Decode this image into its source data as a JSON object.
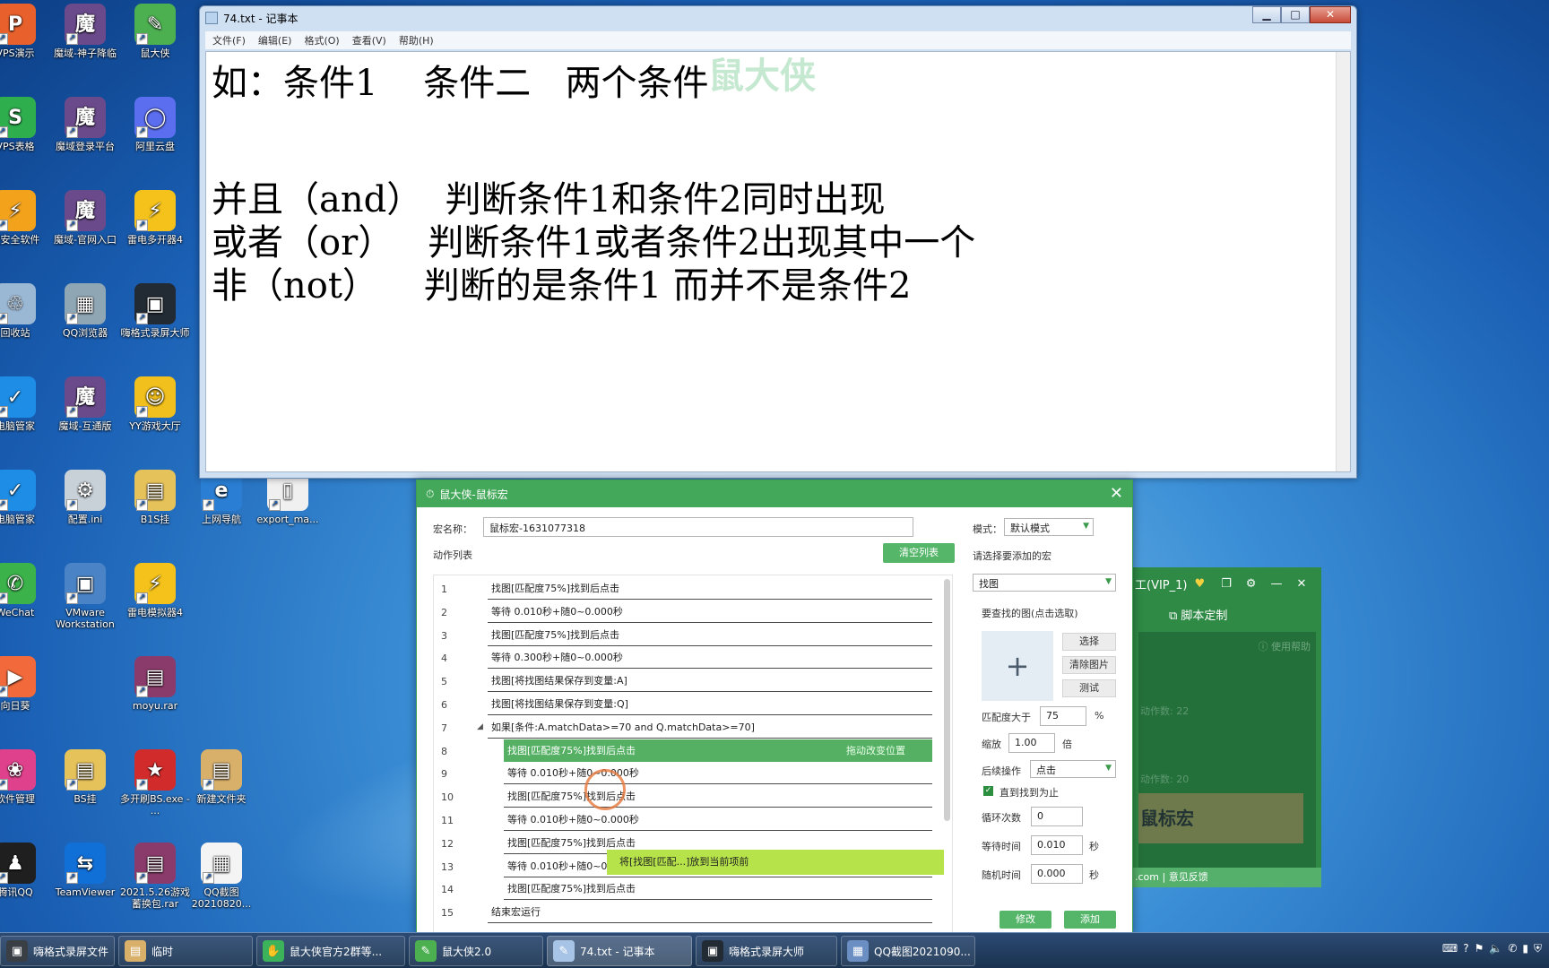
{
  "desktop": {
    "icons": [
      {
        "label": "VPS演示",
        "color": "#e8612c",
        "glyph": "P"
      },
      {
        "label": "魔域-神子降临",
        "color": "#6a4a8a",
        "glyph": "魔"
      },
      {
        "label": "鼠大侠",
        "color": "#4caf50",
        "glyph": "✎"
      },
      {
        "label": "VPS表格",
        "color": "#2fae4e",
        "glyph": "S"
      },
      {
        "label": "魔域登录平台",
        "color": "#6a4a8a",
        "glyph": "魔"
      },
      {
        "label": "阿里云盘",
        "color": "#5b6ef0",
        "glyph": "◯"
      },
      {
        "label": "被安全软件",
        "color": "#f3a21c",
        "glyph": "⚡"
      },
      {
        "label": "魔域-官网入口",
        "color": "#6a4a8a",
        "glyph": "魔"
      },
      {
        "label": "雷电多开器4",
        "color": "#f4c21a",
        "glyph": "⚡"
      },
      {
        "label": "回收站",
        "color": "#9ab7d3",
        "glyph": "♲"
      },
      {
        "label": "QQ浏览器",
        "color": "#8fa6b5",
        "glyph": "▦"
      },
      {
        "label": "嗨格式录屏大师",
        "color": "#222a33",
        "glyph": "▣"
      },
      {
        "label": "电脑管家",
        "color": "#1e8de6",
        "glyph": "✓"
      },
      {
        "label": "魔域-互通版",
        "color": "#6a4a8a",
        "glyph": "魔"
      },
      {
        "label": "YY游戏大厅",
        "color": "#f2c01c",
        "glyph": "☺"
      },
      {
        "label": "电脑管家",
        "color": "#1e8de6",
        "glyph": "✓"
      },
      {
        "label": "配置.ini",
        "color": "#c8d0d8",
        "glyph": "⚙"
      },
      {
        "label": "B1S挂",
        "color": "#e6c25a",
        "glyph": "▤"
      },
      {
        "label": "上网导航",
        "color": "#2a7fd4",
        "glyph": "e"
      },
      {
        "label": "export_ma...",
        "color": "#f0f0f0",
        "glyph": "▯"
      },
      {
        "label": "WeChat",
        "color": "#3bb24a",
        "glyph": "✆"
      },
      {
        "label": "VMware Workstation",
        "color": "#4a84c6",
        "glyph": "▣"
      },
      {
        "label": "雷电模拟器4",
        "color": "#f4c21a",
        "glyph": "⚡"
      },
      {
        "label": "moyu.rar",
        "color": "#8b3b6b",
        "glyph": "▤"
      },
      {
        "label": "向日葵",
        "color": "#f26a3b",
        "glyph": "▶"
      },
      {
        "label": "BS挂",
        "color": "#e6c25a",
        "glyph": "▤"
      },
      {
        "label": "多开刷BS.exe - ...",
        "color": "#d22b2b",
        "glyph": "★"
      },
      {
        "label": "新建文件夹",
        "color": "#d9b06a",
        "glyph": "▤"
      },
      {
        "label": "软件管理",
        "color": "#e0418c",
        "glyph": "❀"
      },
      {
        "label": "腾讯QQ",
        "color": "#1f1f1f",
        "glyph": "♟"
      },
      {
        "label": "TeamViewer",
        "color": "#1170d8",
        "glyph": "⇆"
      },
      {
        "label": "2021.5.26游戏蓄换包.rar",
        "color": "#8b3b6b",
        "glyph": "▤"
      },
      {
        "label": "QQ截图20210820...",
        "color": "#f4f4f4",
        "glyph": "▦"
      }
    ]
  },
  "notepad": {
    "title": "74.txt - 记事本",
    "menu": [
      "文件(F)",
      "编辑(E)",
      "格式(O)",
      "查看(V)",
      "帮助(H)"
    ],
    "watermark": "鼠大侠",
    "lines": [
      "如：条件1    条件二   两个条件",
      "并且（and）  判断条件1和条件2同时出现",
      "或者（or）   判断条件1或者条件2出现其中一个",
      "非（not）    判断的是条件1 而并不是条件2"
    ]
  },
  "macro": {
    "title": "鼠大侠-鼠标宏",
    "name_label": "宏名称：",
    "name_value": "鼠标宏-1631077318",
    "mode_label": "模式：",
    "mode_value": "默认模式",
    "list_label": "动作列表",
    "clear_btn": "清空列表",
    "choose_label": "请选择要添加的宏",
    "choose_value": "找图",
    "find_label": "要查找的图(点击选取)",
    "select_btn": "选择",
    "clear_img_btn": "清除图片",
    "test_btn": "测试",
    "match_label": "匹配度大于",
    "match_value": "75",
    "match_unit": "%",
    "scale_label": "缩放",
    "scale_value": "1.00",
    "scale_unit": "倍",
    "after_label": "后续操作",
    "after_value": "点击",
    "until_found": "直到找到为止",
    "loop_label": "循环次数",
    "loop_value": "0",
    "wait_label": "等待时间",
    "wait_value": "0.010",
    "wait_unit": "秒",
    "rand_label": "随机时间",
    "rand_value": "0.000",
    "rand_unit": "秒",
    "modify_btn": "修改",
    "add_btn": "添加",
    "drag_hint": "拖动改变位置",
    "drop_tip": "将[找图[匹配...]放到当前项前",
    "actions": [
      {
        "num": "1",
        "text": "找图[匹配度75%]找到后点击"
      },
      {
        "num": "2",
        "text": "等待 0.010秒+随0~0.000秒"
      },
      {
        "num": "3",
        "text": "找图[匹配度75%]找到后点击"
      },
      {
        "num": "4",
        "text": "等待 0.300秒+随0~0.000秒"
      },
      {
        "num": "5",
        "text": "找图[将找图结果保存到变量:A]"
      },
      {
        "num": "6",
        "text": "找图[将找图结果保存到变量:Q]"
      },
      {
        "num": "7",
        "text": "如果[条件:A.matchData>=70 and Q.matchData>=70]"
      },
      {
        "num": "8",
        "text": "找图[匹配度75%]找到后点击"
      },
      {
        "num": "9",
        "text": "等待 0.010秒+随0~0.000秒"
      },
      {
        "num": "10",
        "text": "找图[匹配度75%]找到后点击"
      },
      {
        "num": "11",
        "text": "等待 0.010秒+随0~0.000秒"
      },
      {
        "num": "12",
        "text": "找图[匹配度75%]找到后点击"
      },
      {
        "num": "13",
        "text": "等待 0.010秒+随0~0.000秒"
      },
      {
        "num": "14",
        "text": "找图[匹配度75%]找到后点击"
      },
      {
        "num": "15",
        "text": "结束宏运行"
      }
    ]
  },
  "sidepanel": {
    "title": "工(VIP_1)",
    "tab": "脚本定制",
    "help": "ⓘ 使用帮助",
    "count": "动作数: 22",
    "count2": "动作数: 20",
    "strip": "鼠标宏",
    "footer": ".com | 意见反馈"
  },
  "taskbar": {
    "items": [
      {
        "label": "嗨格式录屏文件",
        "color": "#3a3f46",
        "glyph": "▣"
      },
      {
        "label": "临时",
        "color": "#d9b06a",
        "glyph": "▤"
      },
      {
        "label": "鼠大侠官方2群等...",
        "color": "#3cb35a",
        "glyph": "✋"
      },
      {
        "label": "鼠大侠2.0",
        "color": "#4caf50",
        "glyph": "✎"
      },
      {
        "label": "74.txt - 记事本",
        "color": "#a7c4e6",
        "glyph": "✎"
      },
      {
        "label": "嗨格式录屏大师",
        "color": "#222a33",
        "glyph": "▣"
      },
      {
        "label": "QQ截图2021090...",
        "color": "#6b8fc2",
        "glyph": "▦"
      }
    ]
  }
}
